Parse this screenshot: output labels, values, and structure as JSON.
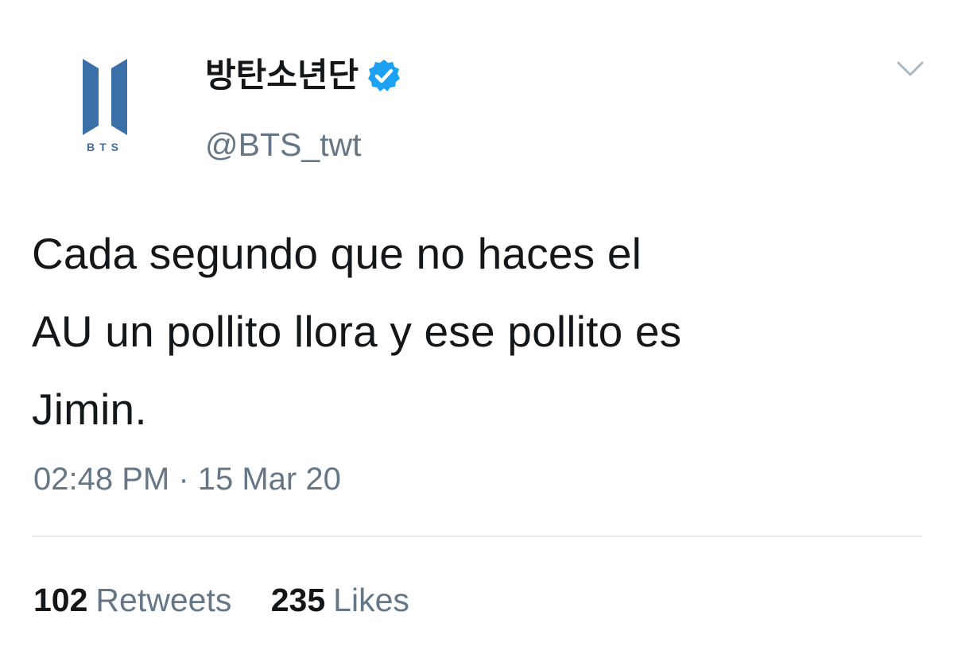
{
  "tweet": {
    "author": {
      "avatar_icon": "bts-logo-icon",
      "avatar_caption": "BTS",
      "avatar_color": "#3b6fa8",
      "display_name": "방탄소년단",
      "verified_icon": "verified-badge-icon",
      "verified_color": "#1da1f2",
      "handle": "@BTS_twt"
    },
    "menu_icon": "chevron-down-icon",
    "text_lines": [
      "Cada segundo que no haces el",
      "AU un pollito llora y ese pollito es",
      "Jimin."
    ],
    "timestamp": "02:48 PM · 15 Mar 20",
    "stats": {
      "retweets_count": "102",
      "retweets_label": "Retweets",
      "likes_count": "235",
      "likes_label": "Likes"
    }
  }
}
